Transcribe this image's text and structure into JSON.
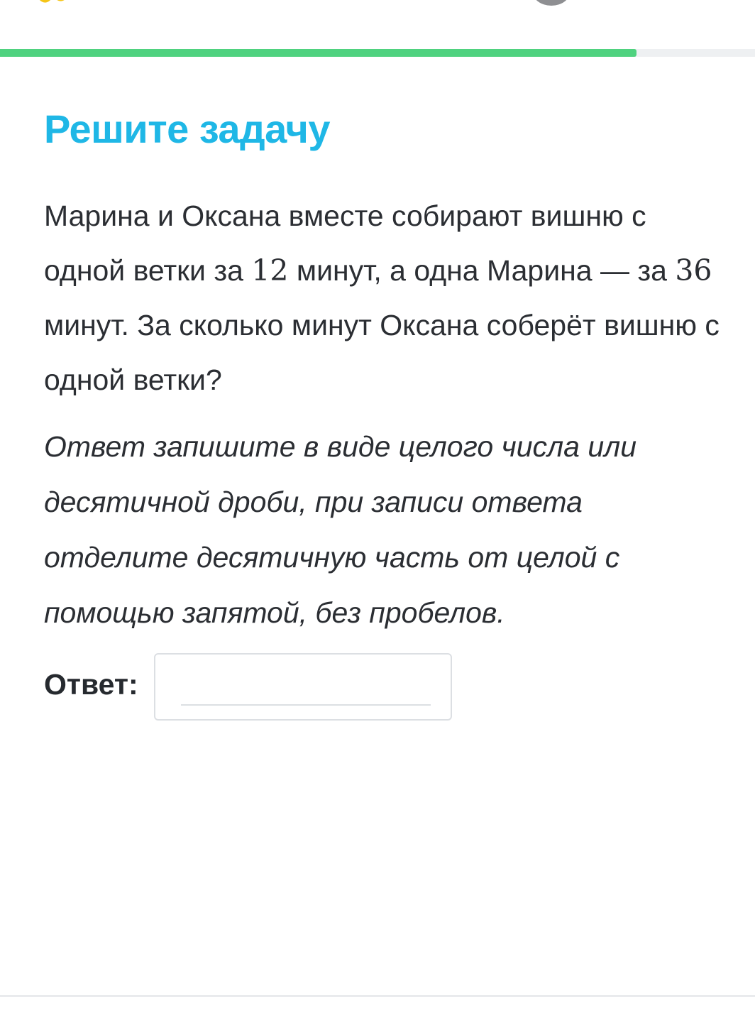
{
  "header": {
    "logo_icon": "app-logo-icon",
    "avatar_icon": "user-avatar-icon",
    "brand_color": "#f5c518"
  },
  "progress": {
    "fraction": 0.843,
    "color": "#4fd27f"
  },
  "task": {
    "title": "Решите задачу",
    "problem": {
      "part1": "Марина и Оксана вместе собирают вишню с одной ветки за ",
      "num1": "12",
      "part2": " минут, а одна Марина — за ",
      "num2": "36",
      "part3": " минут. За сколько минут Оксана соберёт вишню с одной ветки?"
    },
    "instructions": "Ответ запишите в виде целого числа или десятичной дроби, при записи ответа отделите десятичную часть от целой с помощью запятой, без пробелов.",
    "answer_label": "Ответ:",
    "answer_value": ""
  }
}
